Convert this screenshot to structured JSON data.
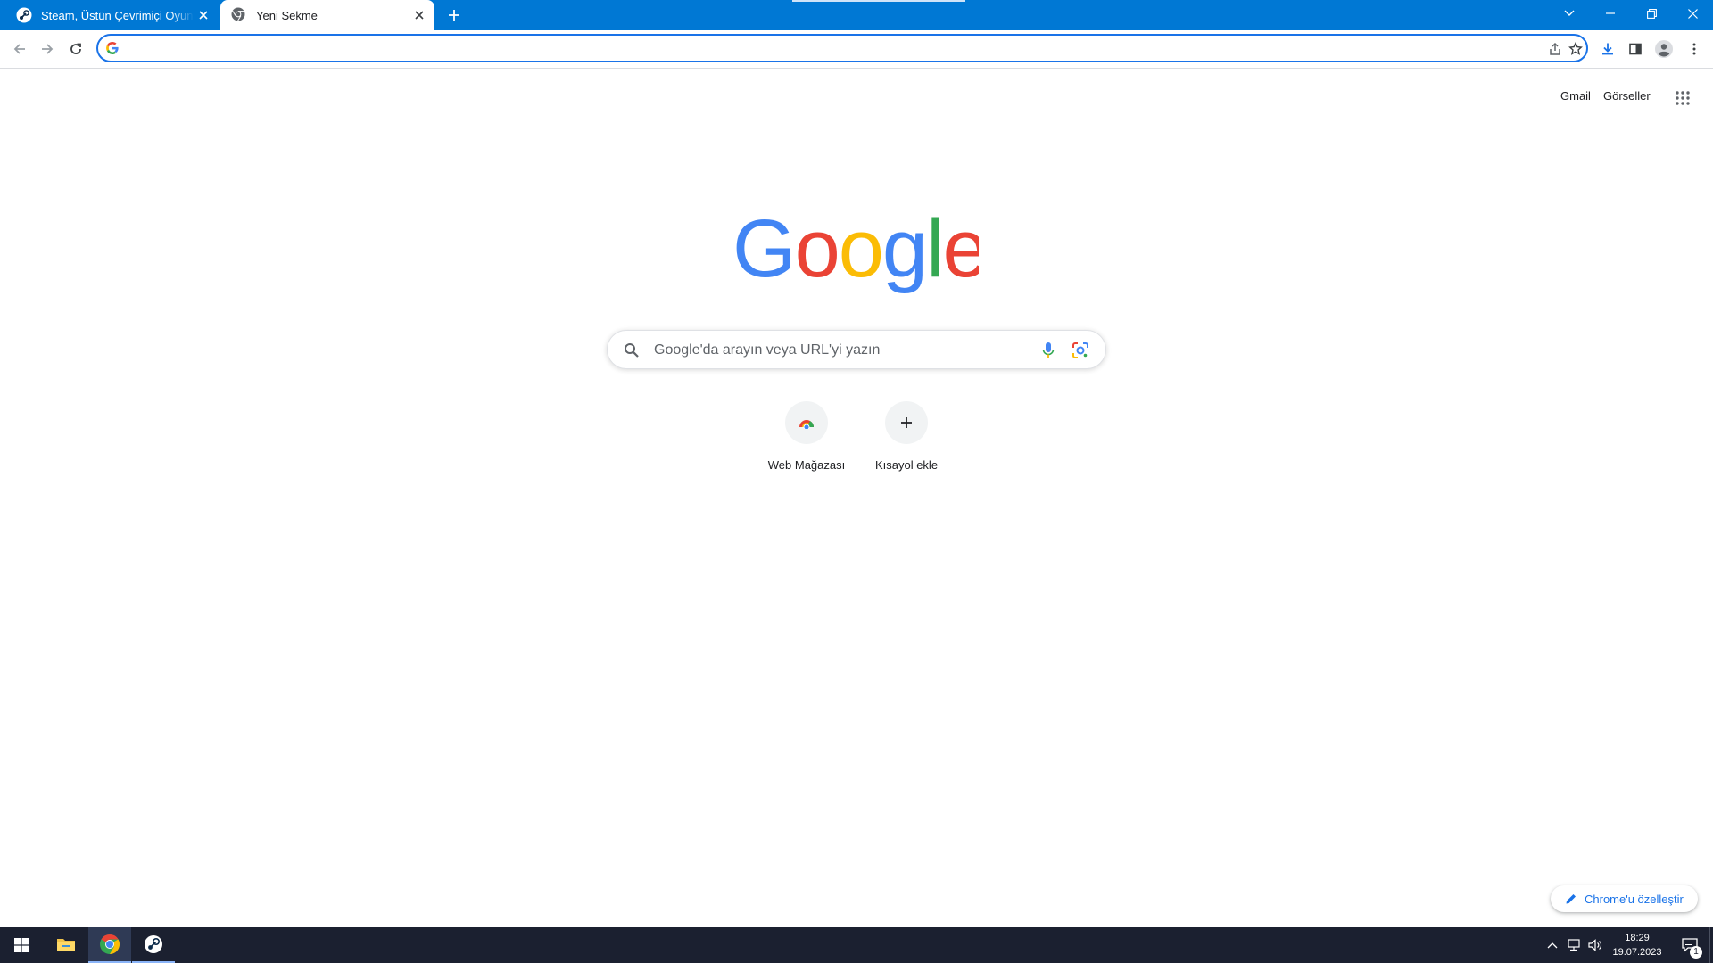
{
  "browser": {
    "tabs": [
      {
        "title": "Steam, Üstün Çevrimiçi Oyun Platformu",
        "active": false,
        "favicon": "steam-icon"
      },
      {
        "title": "Yeni Sekme",
        "active": true,
        "favicon": "chrome-icon"
      }
    ],
    "omnibox": {
      "value": "",
      "placeholder": ""
    }
  },
  "page": {
    "top_links": {
      "gmail": "Gmail",
      "images": "Görseller"
    },
    "logo_text": "Google",
    "search": {
      "placeholder": "Google'da arayın veya URL'yi yazın"
    },
    "shortcuts": [
      {
        "label": "Web Mağazası",
        "icon": "web-store-icon"
      },
      {
        "label": "Kısayol ekle",
        "icon": "plus-icon"
      }
    ],
    "customize_label": "Chrome'u özelleştir"
  },
  "taskbar": {
    "time": "18:29",
    "date": "19.07.2023",
    "notification_count": "1"
  },
  "colors": {
    "titlebar": "#0078d4",
    "accent": "#1a73e8",
    "taskbar": "#1b2030",
    "google_blue": "#4285f4",
    "google_red": "#ea4335",
    "google_yellow": "#fbbc05",
    "google_green": "#34a853"
  }
}
